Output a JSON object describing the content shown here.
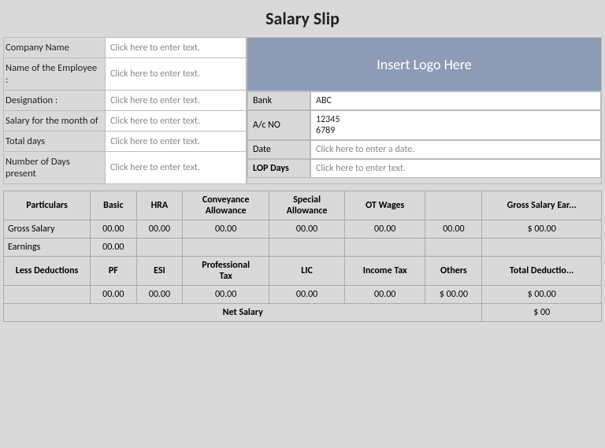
{
  "title": "Salary Slip",
  "fields": {
    "company_name_label": "Company Name",
    "company_name_placeholder": "Click here to enter text.",
    "employee_name_label": "Name of the Employee :",
    "employee_name_placeholder": "Click here to enter text.",
    "designation_label": "Designation :",
    "designation_placeholder": "Click here to enter text.",
    "salary_month_label": "Salary for the month of",
    "salary_month_placeholder": "Click here to enter text.",
    "total_days_label": "Total days",
    "total_days_placeholder": "Click here to enter text.",
    "present_days_label": "Number of Days present",
    "present_days_placeholder": "Click here to enter text."
  },
  "logo_text": "Insert Logo Here",
  "right_info": {
    "bank_label": "Bank",
    "bank_value": "ABC",
    "acno_label": "A/c NO",
    "acno_value": "12345\n6789",
    "acno_value1": "12345",
    "acno_value2": "6789",
    "date_label": "Date",
    "date_placeholder": "Click here to enter a date.",
    "lop_label": "LOP Days",
    "lop_placeholder": "Click here to enter text."
  },
  "salary_table": {
    "headers": [
      "Particulars",
      "Basic",
      "HRA",
      "Conveyance Allowance",
      "Special Allowance",
      "OT Wages",
      "",
      "Gross Salary Earned"
    ],
    "row1": {
      "label": "Gross Salary",
      "basic": "00.00",
      "hra": "00.00",
      "conveyance": "00.00",
      "special": "00.00",
      "ot_wages": "00.00",
      "blank": "00.00",
      "gross": "$ 00.00"
    },
    "row2": {
      "label": "Earnings",
      "basic": "00.00",
      "hra": "",
      "conveyance": "",
      "special": "",
      "ot_wages": "",
      "blank": "",
      "gross": ""
    },
    "deductions_header": "Less Deductions",
    "deductions_cols": [
      "PF",
      "ESI",
      "Professional Tax",
      "LIC",
      "Income Tax",
      "Others",
      "Total Deductions"
    ],
    "deductions_row": {
      "pf": "00.00",
      "esi": "00.00",
      "prof_tax": "00.00",
      "lic": "00.00",
      "income_tax": "00.00",
      "others": "$ 00.00",
      "total": "$ 00.00"
    },
    "net_salary_label": "Net Salary",
    "net_salary_value": "$ 00"
  }
}
